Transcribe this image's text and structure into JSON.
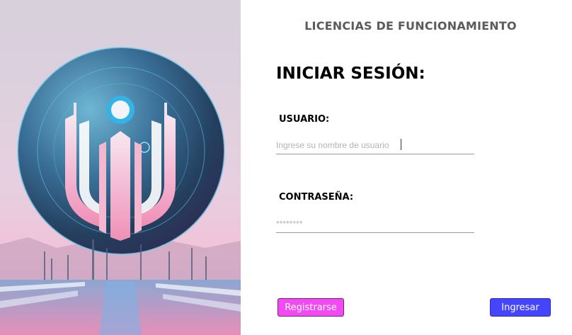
{
  "app": {
    "title": "LICENCIAS DE FUNCIONAMIENTO"
  },
  "login": {
    "heading": "INICIAR SESIÓN:",
    "username_label": "USUARIO:",
    "username_placeholder": "Ingrese su nombre de usuario",
    "username_value": "",
    "password_label": "CONTRASEÑA:",
    "password_placeholder": "********",
    "password_value": ""
  },
  "buttons": {
    "register_label": "Registrarse",
    "login_label": "Ingresar"
  },
  "colors": {
    "register_button": "#f24af2",
    "login_button": "#4545ff",
    "title_text": "#5b5b5b"
  },
  "icons": {
    "hero_art": "futuristic-planet-logo-illustration"
  }
}
